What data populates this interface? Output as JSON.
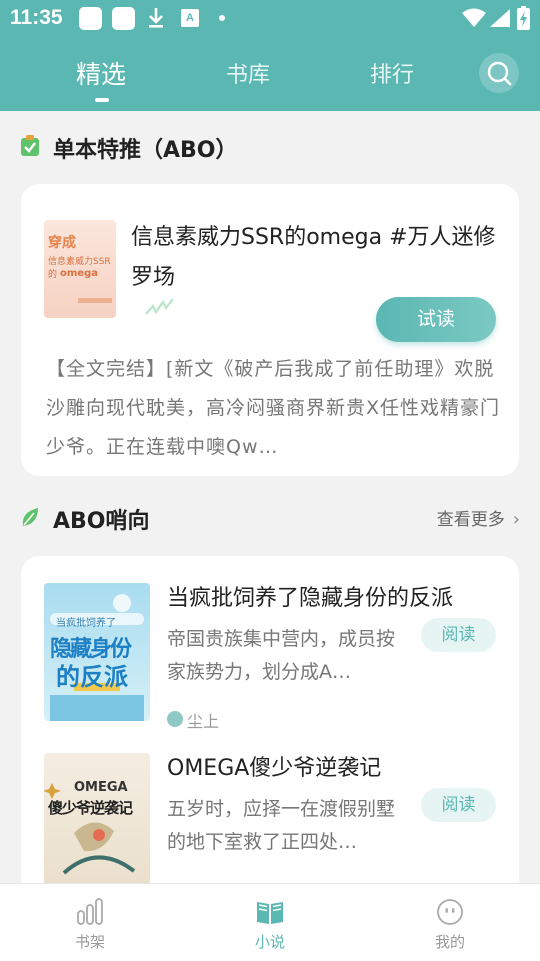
{
  "status_bar": {
    "time": "11:35"
  },
  "tabs": [
    {
      "label": "精选",
      "active": true
    },
    {
      "label": "书库",
      "active": false
    },
    {
      "label": "排行",
      "active": false
    }
  ],
  "section1": {
    "title": "单本特推（ABO）",
    "book": {
      "cover_text": [
        "穿成",
        "信息素威力SSR的",
        "omega"
      ],
      "title": "信息素威力SSR的omega #万人迷修罗场",
      "read_label": "试读",
      "description": "【全文完结】[新文《破产后我成了前任助理》欢脱沙雕向现代耽美，高冷闷骚商界新贵X任性戏精豪门少爷。正在连载中噢Qw…"
    }
  },
  "section2": {
    "title": "ABO哨向",
    "more_label": "查看更多",
    "books": [
      {
        "cover_text": [
          "当疯批饲养了",
          "隐藏身份",
          "的反派"
        ],
        "title": "当疯批饲养了隐藏身份的反派",
        "description": "帝国贵族集中营内，成员按家族势力，划分成A…",
        "author": "尘上",
        "read_label": "阅读"
      },
      {
        "cover_text": [
          "OMEGA",
          "傻少爷逆袭记"
        ],
        "title": "OMEGA傻少爷逆袭记",
        "description": "五岁时，应择一在渡假别墅的地下室救了正四处…",
        "author": "",
        "read_label": "阅读"
      }
    ]
  },
  "bottom_nav": [
    {
      "label": "书架",
      "icon": "bookshelf-icon",
      "active": false
    },
    {
      "label": "小说",
      "icon": "open-book-icon",
      "active": true
    },
    {
      "label": "我的",
      "icon": "profile-face-icon",
      "active": false
    }
  ],
  "colors": {
    "accent": "#5ab7b2",
    "accent_light": "#e6f5f4",
    "background": "#f2f2f2"
  }
}
